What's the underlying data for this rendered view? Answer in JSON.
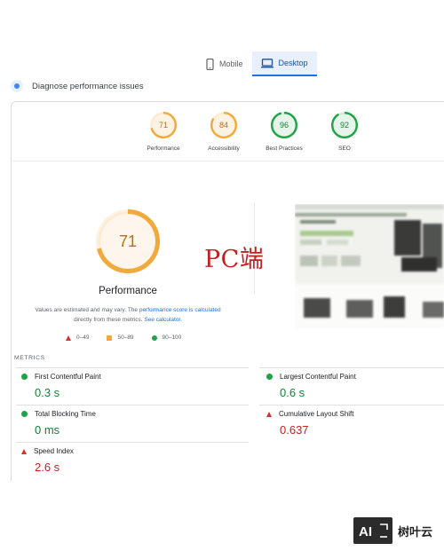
{
  "device_tabs": [
    {
      "label": "Mobile",
      "icon": "mobile-phone-icon",
      "active": false
    },
    {
      "label": "Desktop",
      "icon": "desktop-monitor-icon",
      "active": true
    }
  ],
  "diagnose": {
    "label": "Diagnose performance issues"
  },
  "categories": [
    {
      "score": "71",
      "label": "Performance",
      "value": 71,
      "color": "#f2a93b",
      "text_color": "#b5701b"
    },
    {
      "score": "84",
      "label": "Accessibility",
      "value": 84,
      "color": "#f2a93b",
      "text_color": "#b5701b"
    },
    {
      "score": "96",
      "label": "Best Practices",
      "value": 96,
      "color": "#1ea446",
      "text_color": "#188038"
    },
    {
      "score": "92",
      "label": "SEO",
      "value": 92,
      "color": "#1ea446",
      "text_color": "#188038"
    }
  ],
  "performance": {
    "score": "71",
    "value": 71,
    "label": "Performance",
    "note_before": "Values are estimated and may vary. The ",
    "note_link1": "performance score is calculated",
    "note_middle": " directly from these metrics. ",
    "note_link2": "See calculator",
    "note_after": "."
  },
  "legend": [
    {
      "range": "0–49",
      "shape": "triangle",
      "color": "#d93025"
    },
    {
      "range": "50–89",
      "shape": "square",
      "color": "#f2a93b"
    },
    {
      "range": "90–100",
      "shape": "circle",
      "color": "#1ea446"
    }
  ],
  "annotation": {
    "text": "PC端"
  },
  "metrics": {
    "title": "METRICS",
    "items": [
      {
        "name": "First Contentful Paint",
        "value": "0.3 s",
        "status": "good"
      },
      {
        "name": "Largest Contentful Paint",
        "value": "0.6 s",
        "status": "good"
      },
      {
        "name": "Total Blocking Time",
        "value": "0 ms",
        "status": "good"
      },
      {
        "name": "Cumulative Layout Shift",
        "value": "0.637",
        "status": "poor"
      },
      {
        "name": "Speed Index",
        "value": "2.6 s",
        "status": "poor"
      }
    ]
  },
  "watermark": {
    "logo_text": "AI",
    "text": "树叶云"
  }
}
